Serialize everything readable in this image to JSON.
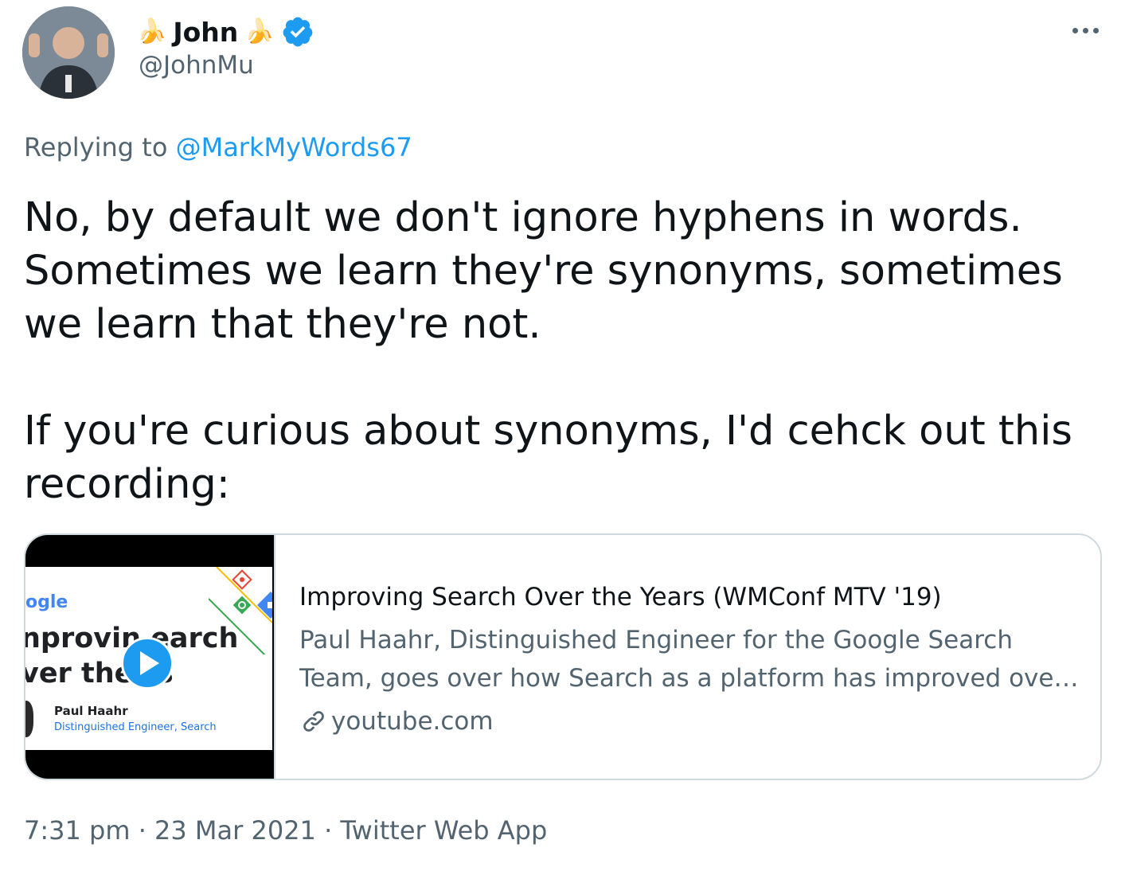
{
  "author": {
    "name": "John",
    "handle": "@JohnMu",
    "emoji": "🍌",
    "verified_color": "#1d9bf0"
  },
  "reply": {
    "prefix": "Replying to",
    "mention": "@MarkMyWords67"
  },
  "tweet": {
    "paragraph1": "No, by default we don't ignore hyphens in words. Sometimes we learn they're synonyms, sometimes we learn that they're not.",
    "paragraph2": "If you're curious about synonyms, I'd cehck out this recording:"
  },
  "card": {
    "title": "Improving Search Over the Years (WMConf MTV '19)",
    "description": "Paul Haahr, Distinguished Engineer for the Google Search Team, goes over how Search as a platform has improved over the years...",
    "domain": "youtube.com",
    "thumbnail": {
      "logo": "ogle",
      "title_line1": "nprovin   earch",
      "title_line2": "ver the   rs",
      "speaker": "Paul Haahr",
      "role": "Distinguished Engineer, Search"
    }
  },
  "meta": {
    "text": "7:31 pm · 23 Mar 2021 · Twitter Web App"
  },
  "colors": {
    "accent": "#1d9bf0",
    "secondary_text": "#536471",
    "border": "#cfd9de"
  }
}
